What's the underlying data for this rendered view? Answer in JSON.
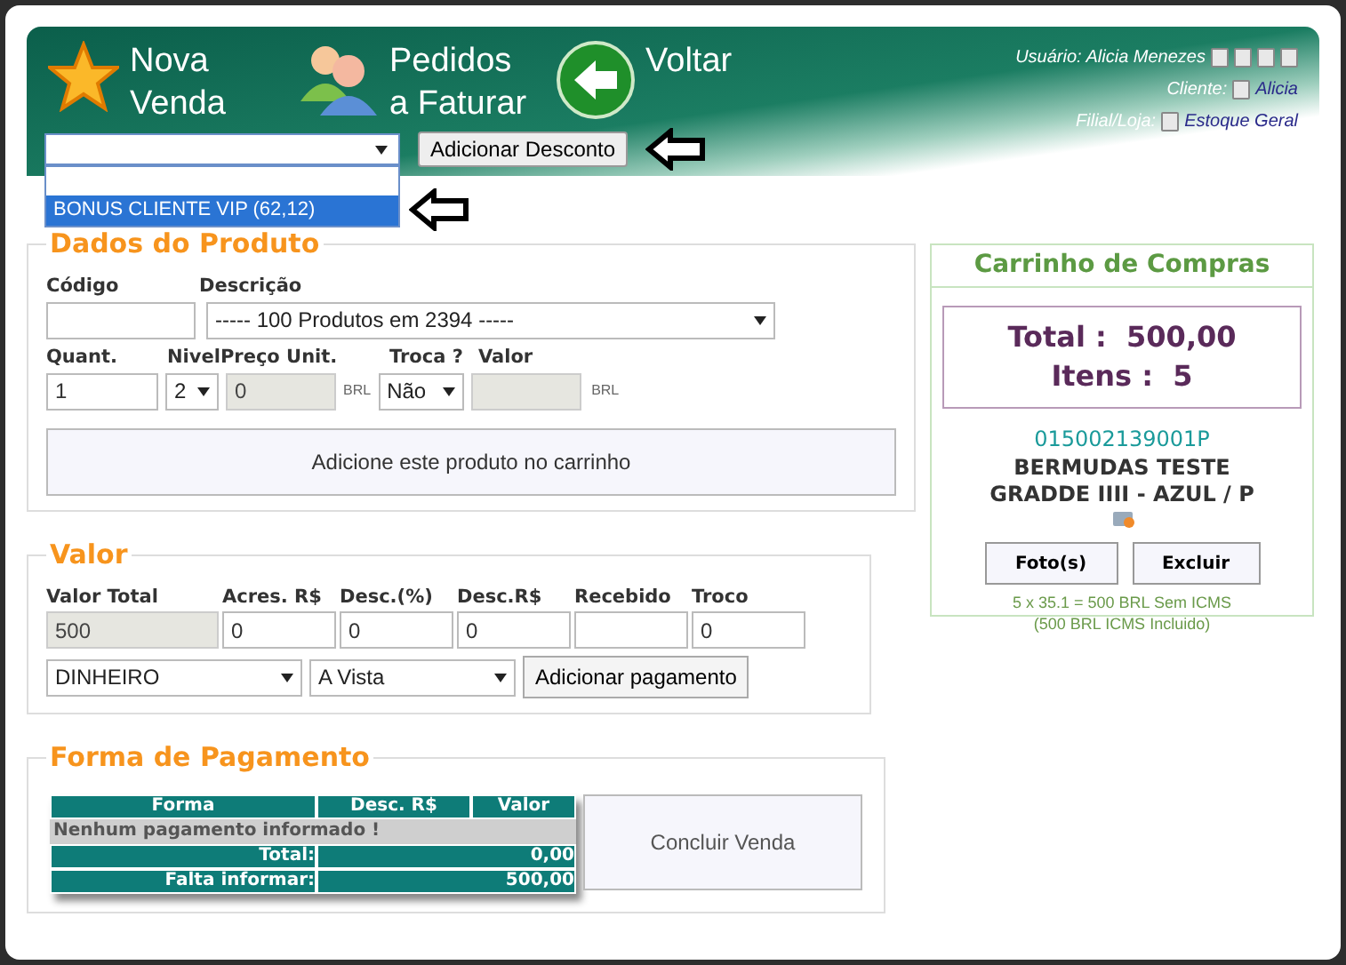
{
  "header": {
    "nav": [
      {
        "kind": "star",
        "label": "Nova Venda"
      },
      {
        "kind": "people",
        "label": "Pedidos a Faturar"
      },
      {
        "kind": "back",
        "label": "Voltar"
      }
    ],
    "user": {
      "label": "Usuário:",
      "value": "Alicia Menezes"
    },
    "client": {
      "label": "Cliente:",
      "value": "Alicia"
    },
    "store": {
      "label": "Filial/Loja:",
      "value": "Estoque Geral"
    }
  },
  "discount": {
    "expanded": true,
    "options": [
      {
        "label": "BONUS CLIENTE VIP (62,12)",
        "selected": true
      }
    ],
    "button": "Adicionar Desconto"
  },
  "product": {
    "legend": "Dados do Produto",
    "code_label": "Código",
    "description_label": "Descrição",
    "description": "----- 100 Produtos em 2394 -----",
    "quantity_label": "Quant.",
    "quantity": "1",
    "level_label": "Nivel",
    "level_value": "2",
    "price_label": "Preço Unit.",
    "price": "0",
    "price_currency": "BRL",
    "exchange_label": "Troca ?",
    "exchange": "Não",
    "value_label": "Valor",
    "value_currency": "BRL",
    "add_button": "Adicione este produto no carrinho"
  },
  "valor": {
    "legend": "Valor",
    "fields": [
      {
        "label": "Valor Total",
        "value": "500",
        "disabled": true
      },
      {
        "label": "Acres. R$",
        "value": "0",
        "disabled": false
      },
      {
        "label": "Desc.(%)",
        "value": "0",
        "disabled": false
      },
      {
        "label": "Desc.R$",
        "value": "0",
        "disabled": false
      },
      {
        "label": "Recebido",
        "disabled": false
      },
      {
        "label": "Troco",
        "value": "0",
        "disabled": false
      }
    ],
    "method": "DINHEIRO",
    "term": "A Vista",
    "add_button": "Adicionar pagamento"
  },
  "payment": {
    "legend": "Forma de Pagamento",
    "columns": [
      "Forma",
      "Desc. R$",
      "Valor"
    ],
    "empty_message": "Nenhum pagamento informado !",
    "total_label": "Total:",
    "total": "0,00",
    "missing_label": "Falta informar:",
    "missing": "500,00",
    "finish_button": "Concluir Venda"
  },
  "cart": {
    "title": "Carrinho de Compras",
    "total": "Total :  500,00",
    "items": "Itens :  5",
    "product_code": "015002139001P",
    "product_name": "BERMUDAS TESTE GRADDE IIII - AZUL / P",
    "photo_button": "Foto(s)",
    "delete_button": "Excluir",
    "calc": "5 x 35.1 = 500 BRL Sem ICMS",
    "calc_note": "(500 BRL ICMS Incluido)"
  }
}
